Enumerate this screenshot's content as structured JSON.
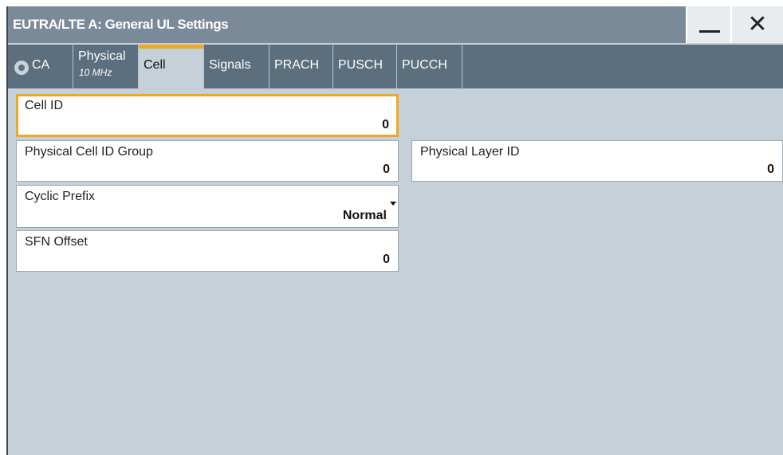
{
  "window": {
    "title": "EUTRA/LTE A: General UL Settings",
    "minimize_icon": "minimize-icon",
    "close_icon": "close-icon",
    "close_glyph": "✕"
  },
  "tabs": {
    "active": "Cell",
    "items": [
      {
        "label": "CA",
        "icon": "radio-icon"
      },
      {
        "label": "Physical",
        "sublabel": "10 MHz"
      },
      {
        "label": "Cell"
      },
      {
        "label": "Signals"
      },
      {
        "label": "PRACH"
      },
      {
        "label": "PUSCH"
      },
      {
        "label": "PUCCH"
      }
    ]
  },
  "fields": {
    "cell_id": {
      "label": "Cell ID",
      "value": "0"
    },
    "physical_cell_id_group": {
      "label": "Physical Cell ID Group",
      "value": "0"
    },
    "physical_layer_id": {
      "label": "Physical Layer ID",
      "value": "0"
    },
    "cyclic_prefix": {
      "label": "Cyclic Prefix",
      "value": "Normal"
    },
    "sfn_offset": {
      "label": "SFN Offset",
      "value": "0"
    }
  },
  "colors": {
    "titlebar": "#7b8a99",
    "tabbar": "#5b6f7e",
    "panel": "#c5d0d8",
    "focus_accent": "#f2a81d"
  }
}
